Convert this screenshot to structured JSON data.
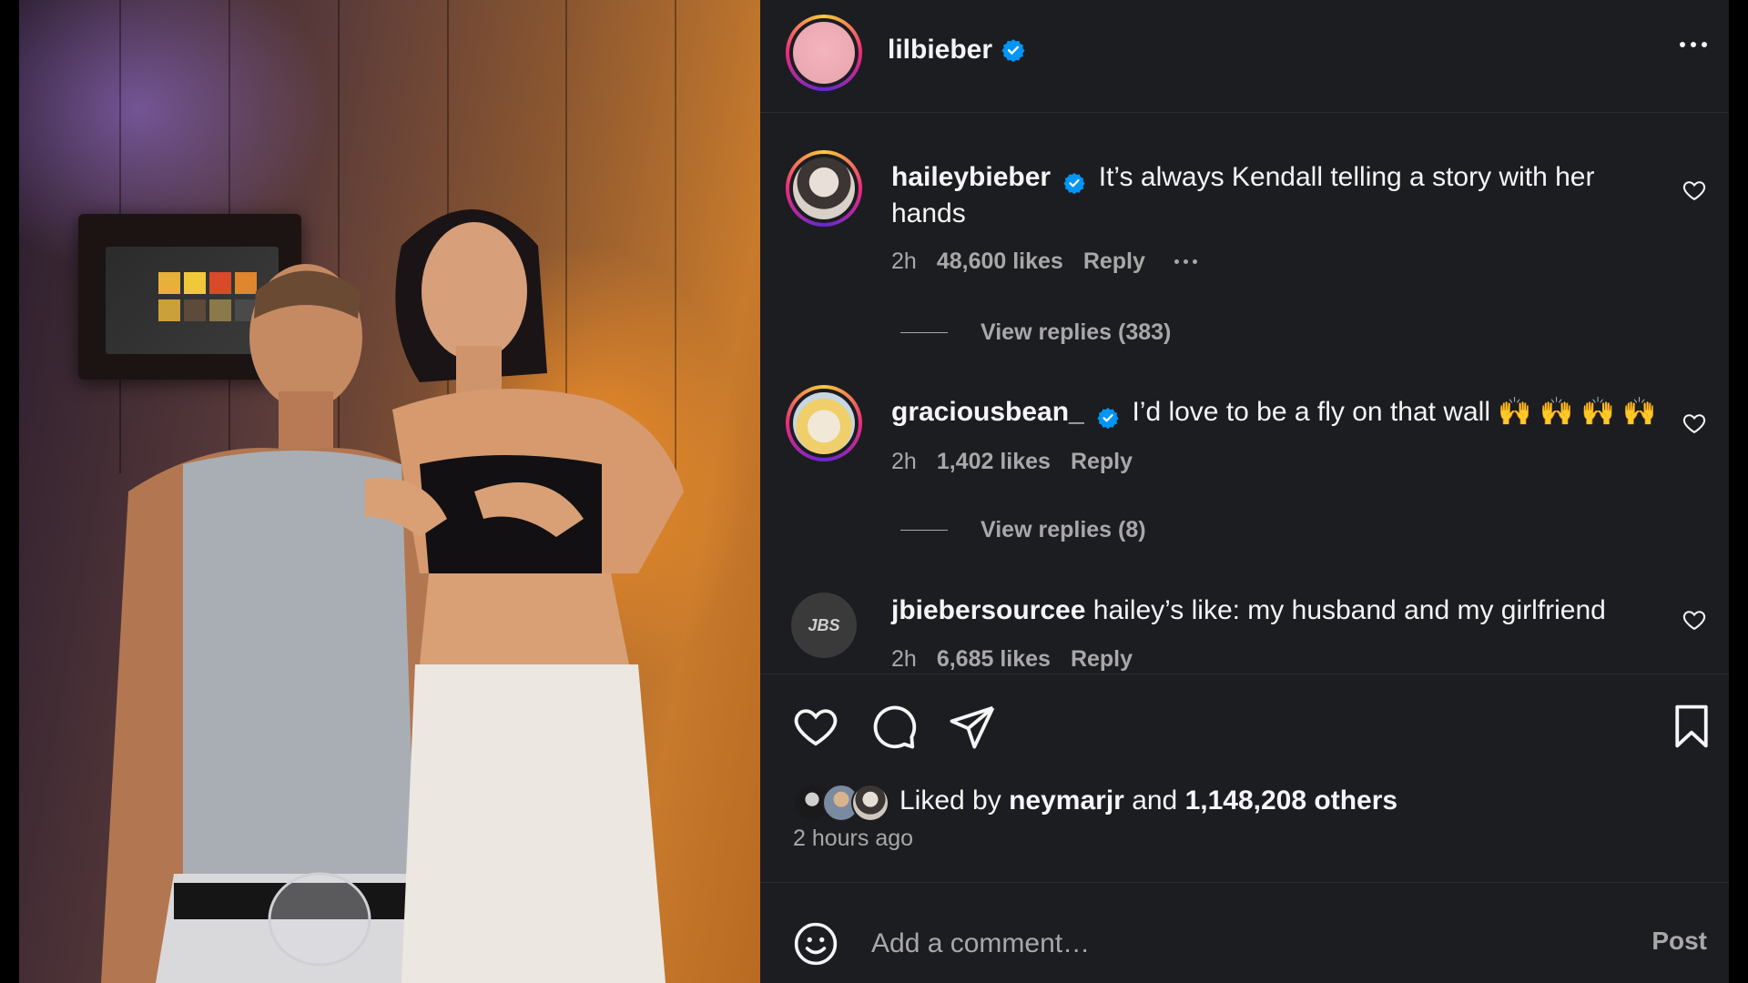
{
  "post": {
    "author": "lilbieber",
    "more_icon": "more-horizontal-icon"
  },
  "comments": [
    {
      "username": "haileybieber",
      "text": "It’s always Kendall telling a story with her hands",
      "time": "2h",
      "likes": "48,600 likes",
      "reply": "Reply",
      "view_replies": "View replies (383)"
    },
    {
      "username": "graciousbean_",
      "text": "I’d love to be a fly on that wall 🙌 🙌 🙌 🙌",
      "time": "2h",
      "likes": "1,402 likes",
      "reply": "Reply",
      "view_replies": "View replies (8)"
    },
    {
      "username": "jbiebersourcee",
      "avatar_text": "JBS",
      "text": "hailey’s like: my husband and my girlfriend",
      "time": "2h",
      "likes": "6,685 likes",
      "reply": "Reply"
    }
  ],
  "actions": {
    "liked_prefix": "Liked by",
    "liked_user": "neymarjr",
    "liked_and": "and",
    "liked_count": "1,148,208 others",
    "time_ago": "2 hours ago"
  },
  "composer": {
    "placeholder": "Add a comment…",
    "post_label": "Post"
  },
  "colors": {
    "panel_bg": "#1c1d20",
    "verified_blue": "#0095f6",
    "muted_text": "#a8a8a8"
  }
}
